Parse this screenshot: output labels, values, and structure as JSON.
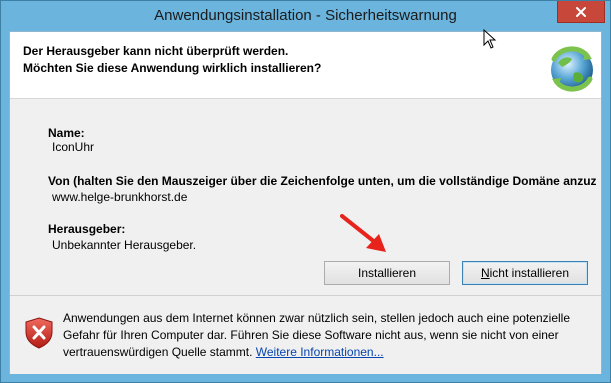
{
  "window": {
    "title": "Anwendungsinstallation - Sicherheitswarnung",
    "close_icon": "close-icon"
  },
  "header": {
    "line1": "Der Herausgeber kann nicht überprüft werden.",
    "line2": "Möchten Sie diese Anwendung wirklich installieren?",
    "icon": "clickonce-globe-icon"
  },
  "details": {
    "name_label": "Name:",
    "name_value": "IconUhr",
    "from_label": "Von (halten Sie den Mauszeiger über die Zeichenfolge unten, um die vollständige Domäne anzuzei",
    "from_value": "www.helge-brunkhorst.de",
    "publisher_label": "Herausgeber:",
    "publisher_value": "Unbekannter Herausgeber."
  },
  "buttons": {
    "install": "Installieren",
    "cancel_prefix": "N",
    "cancel_rest": "icht installieren"
  },
  "warning": {
    "text": "Anwendungen aus dem Internet können zwar nützlich sein, stellen jedoch auch eine potenzielle Gefahr für Ihren Computer dar. Führen Sie diese Software nicht aus, wenn sie nicht von einer vertrauenswürdigen Quelle stammt.",
    "link": "Weitere Informationen...",
    "icon": "security-shield-icon"
  },
  "annotation": {
    "arrow_color": "#e8231b"
  }
}
